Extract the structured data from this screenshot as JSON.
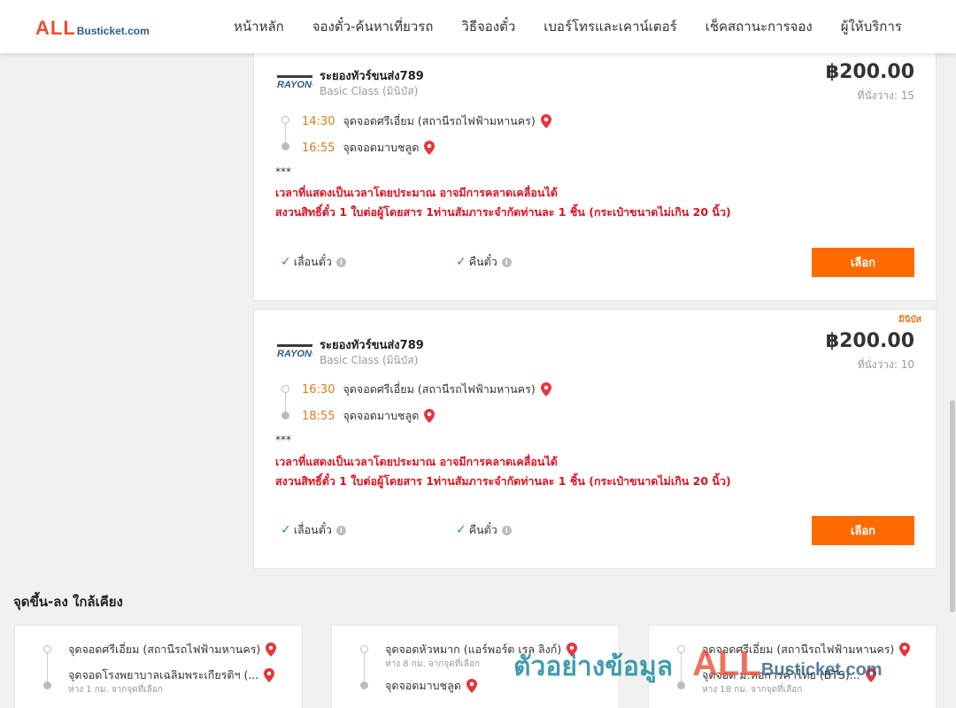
{
  "header": {
    "logo_main": "ALL",
    "logo_sub": "Busticket.com",
    "nav": [
      "หน้าหลัก",
      "จองตั๋ว-ค้นหาเที่ยวรถ",
      "วิธีจองตั๋ว",
      "เบอร์โทรและเคาน์เตอร์",
      "เช็คสถานะการจอง",
      "ผู้ให้บริการ"
    ]
  },
  "trips": [
    {
      "operator": "ระยองทัวร์ขนส่ง789",
      "class": "Basic Class (มินิบัส)",
      "price": "฿200.00",
      "seats": "ที่นั่งว่าง: 15",
      "badge": "",
      "depart_time": "14:30",
      "depart_stop": "จุดจอดศรีเอี่ยม (สถานีรถไฟฟ้ามหานคร)",
      "arrive_time": "16:55",
      "arrive_stop": "จุดจอดมาบชลูด",
      "stars": "***",
      "notice1": "เวลาที่แสดงเป็นเวลาโดยประมาณ อาจมีการคลาดเคลื่อนได้",
      "notice2": "สงวนสิทธิ์ตั๋ว 1 ใบต่อผู้โดยสาร 1ท่านสัมภาระจำกัดท่านละ 1 ชิ้น (กระเป๋าขนาดไม่เกิน 20 นิ้ว)",
      "policy_change": "เลื่อนตั๋ว",
      "policy_refund": "คืนตั๋ว",
      "select": "เลือก"
    },
    {
      "operator": "ระยองทัวร์ขนส่ง789",
      "class": "Basic Class (มินิบัส)",
      "price": "฿200.00",
      "seats": "ที่นั่งว่าง: 10",
      "badge": "มินิบัส",
      "depart_time": "16:30",
      "depart_stop": "จุดจอดศรีเอี่ยม (สถานีรถไฟฟ้ามหานคร)",
      "arrive_time": "18:55",
      "arrive_stop": "จุดจอดมาบชลูด",
      "stars": "***",
      "notice1": "เวลาที่แสดงเป็นเวลาโดยประมาณ อาจมีการคลาดเคลื่อนได้",
      "notice2": "สงวนสิทธิ์ตั๋ว 1 ใบต่อผู้โดยสาร 1ท่านสัมภาระจำกัดท่านละ 1 ชิ้น (กระเป๋าขนาดไม่เกิน 20 นิ้ว)",
      "policy_change": "เลื่อนตั๋ว",
      "policy_refund": "คืนตั๋ว",
      "select": "เลือก"
    }
  ],
  "nearby": {
    "title": "จุดขึ้น-ลง ใกล้เคียง",
    "cards": [
      {
        "from": "จุดจอดศรีเอี่ยม (สถานีรถไฟฟ้ามหานคร)",
        "from_dist": "",
        "to": "จุดจอดโรงพยาบาลเฉลิมพระเกียรติฯ (...",
        "to_dist": "ห่าง 1 กม. จากจุดที่เลือก"
      },
      {
        "from": "จุดจอดหัวหมาก (แอร์พอร์ต เรล ลิงก์)",
        "from_dist": "ห่าง 8 กม. จากจุดที่เลือก",
        "to": "จุดจอดมาบชลูด",
        "to_dist": ""
      },
      {
        "from": "จุดจอดศรีเอี่ยม (สถานีรถไฟฟ้ามหานคร)",
        "from_dist": "",
        "to": "จุดจอด ม.หอการค้าไทย (BTS)...",
        "to_dist": "ห่าง 18 กม. จากจุดที่เลือก"
      }
    ]
  },
  "watermark": {
    "thai": "ตัวอย่างข้อมูล",
    "brand_main": "ALL",
    "brand_sub": "Busticket.com"
  },
  "colors": {
    "brand_red": "#ef4b35",
    "brand_blue": "#2d5e8a",
    "accent_orange": "#ff6a00",
    "time_orange": "#e77816",
    "notice_red": "#e0101f",
    "check_green": "#2e9d3c"
  }
}
